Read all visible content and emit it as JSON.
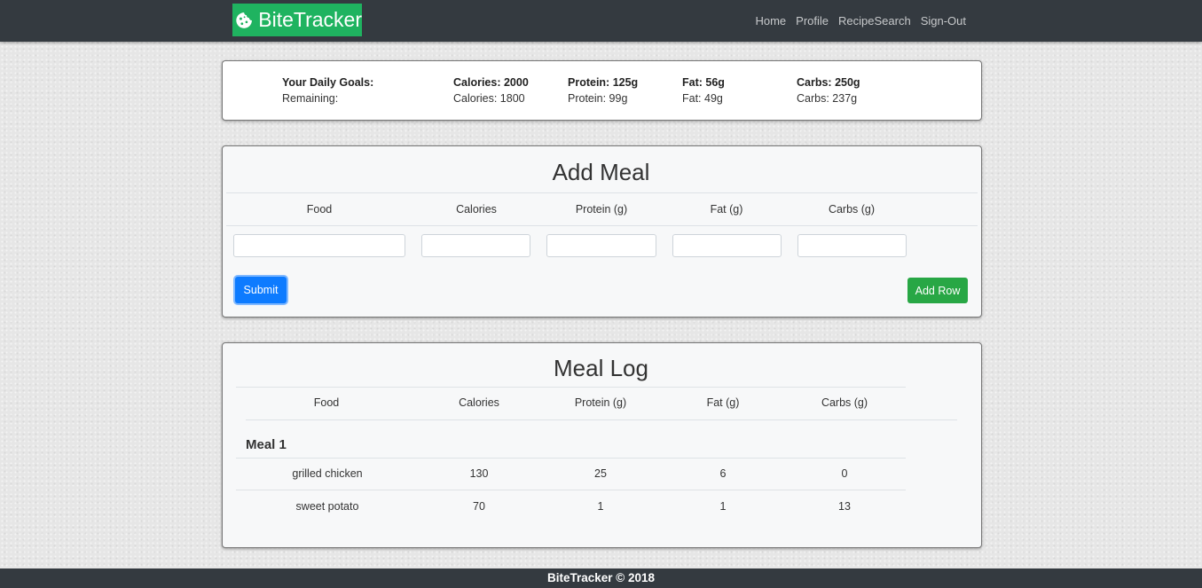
{
  "brand": {
    "name": "BiteTracker",
    "icon": "cookie-icon"
  },
  "nav": {
    "items": [
      "Home",
      "Profile",
      "RecipeSearch",
      "Sign-Out"
    ]
  },
  "goals": {
    "goal_label": "Your Daily Goals:",
    "remaining_label": "Remaining:",
    "goal_values": [
      "Calories: 2000",
      "Protein: 125g",
      "Fat: 56g",
      "Carbs: 250g"
    ],
    "remaining_values": [
      "Calories: 1800",
      "Protein: 99g",
      "Fat: 49g",
      "Carbs: 237g"
    ]
  },
  "add_meal": {
    "title": "Add Meal",
    "columns": [
      "Food",
      "Calories",
      "Protein (g)",
      "Fat (g)",
      "Carbs (g)"
    ],
    "inputs": [
      "",
      "",
      "",
      "",
      ""
    ],
    "submit_label": "Submit",
    "add_row_label": "Add Row"
  },
  "meal_log": {
    "title": "Meal Log",
    "columns": [
      "Food",
      "Calories",
      "Protein (g)",
      "Fat (g)",
      "Carbs (g)"
    ],
    "meals": [
      {
        "name": "Meal 1",
        "rows": [
          [
            "grilled chicken",
            "130",
            "25",
            "6",
            "0"
          ],
          [
            "sweet potato",
            "70",
            "1",
            "1",
            "13"
          ]
        ]
      }
    ]
  },
  "footer": {
    "text": "BiteTracker © 2018"
  },
  "colors": {
    "navbar": "#343a40",
    "brand": "#1fb360",
    "primary": "#0d7bff",
    "success": "#28a745"
  }
}
